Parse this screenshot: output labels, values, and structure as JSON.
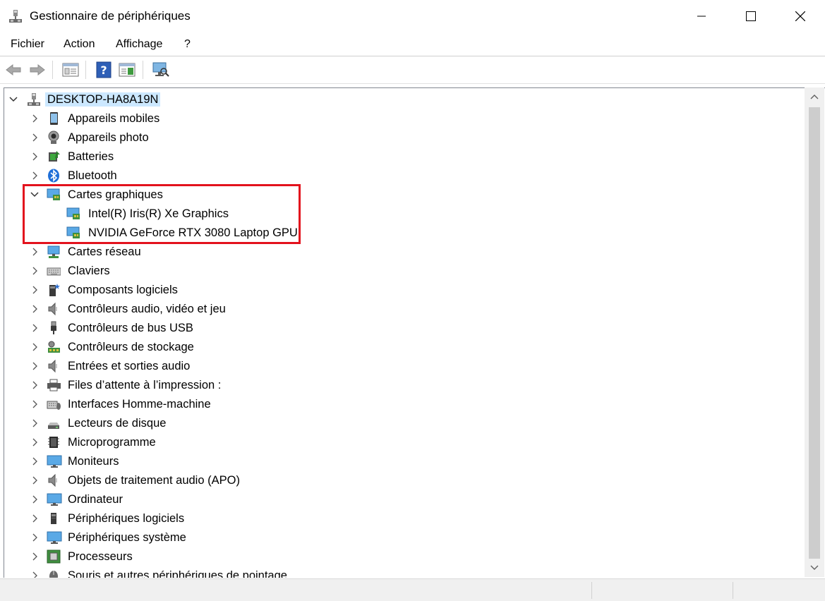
{
  "window": {
    "title": "Gestionnaire de périphériques"
  },
  "menu": {
    "items": [
      "Fichier",
      "Action",
      "Affichage",
      "?"
    ]
  },
  "toolbar": {
    "icons": [
      "back-arrow-icon",
      "forward-arrow-icon",
      "properties-icon",
      "help-icon",
      "view-icon",
      "scan-hardware-icon"
    ]
  },
  "tree": {
    "root": "DESKTOP-HA8A19N",
    "items": [
      {
        "label": "Appareils mobiles",
        "icon": "mobile-device-icon",
        "expanded": false
      },
      {
        "label": "Appareils photo",
        "icon": "camera-icon",
        "expanded": false
      },
      {
        "label": "Batteries",
        "icon": "battery-icon",
        "expanded": false
      },
      {
        "label": "Bluetooth",
        "icon": "bluetooth-icon",
        "expanded": false
      },
      {
        "label": "Cartes graphiques",
        "icon": "display-adapter-icon",
        "expanded": true,
        "children": [
          "Intel(R) Iris(R) Xe Graphics",
          "NVIDIA GeForce RTX 3080 Laptop GPU"
        ]
      },
      {
        "label": "Cartes réseau",
        "icon": "network-adapter-icon",
        "expanded": false
      },
      {
        "label": "Claviers",
        "icon": "keyboard-icon",
        "expanded": false
      },
      {
        "label": "Composants logiciels",
        "icon": "software-component-icon",
        "expanded": false
      },
      {
        "label": "Contrôleurs audio, vidéo et jeu",
        "icon": "speaker-icon",
        "expanded": false
      },
      {
        "label": "Contrôleurs de bus USB",
        "icon": "usb-icon",
        "expanded": false
      },
      {
        "label": "Contrôleurs de stockage",
        "icon": "storage-controller-icon",
        "expanded": false
      },
      {
        "label": "Entrées et sorties audio",
        "icon": "audio-io-icon",
        "expanded": false
      },
      {
        "label": "Files d’attente à l’impression :",
        "icon": "printer-icon",
        "expanded": false
      },
      {
        "label": "Interfaces Homme-machine",
        "icon": "hid-icon",
        "expanded": false
      },
      {
        "label": "Lecteurs de disque",
        "icon": "disk-drive-icon",
        "expanded": false
      },
      {
        "label": "Microprogramme",
        "icon": "firmware-icon",
        "expanded": false
      },
      {
        "label": "Moniteurs",
        "icon": "monitor-icon",
        "expanded": false
      },
      {
        "label": "Objets de traitement audio (APO)",
        "icon": "audio-apo-icon",
        "expanded": false
      },
      {
        "label": "Ordinateur",
        "icon": "computer-icon",
        "expanded": false
      },
      {
        "label": "Périphériques logiciels",
        "icon": "software-device-icon",
        "expanded": false
      },
      {
        "label": "Périphériques système",
        "icon": "system-device-icon",
        "expanded": false
      },
      {
        "label": "Processeurs",
        "icon": "processor-icon",
        "expanded": false
      },
      {
        "label": "Souris et autres périphériques de pointage",
        "icon": "mouse-icon",
        "expanded": false
      }
    ]
  },
  "colors": {
    "selection": "#cce8ff",
    "highlight": "#e3121d",
    "scrollbar": "#f0f0f0"
  }
}
